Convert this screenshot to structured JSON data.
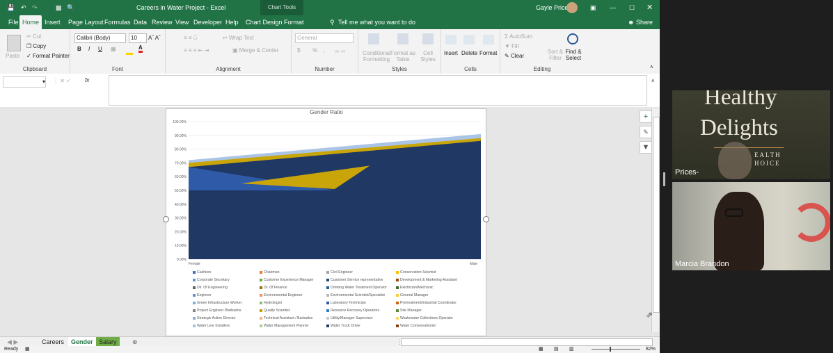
{
  "window": {
    "title": "Careers in Water Project  -  Excel",
    "context_title": "Chart Tools",
    "user": "Gayle Price",
    "share_label": "Share"
  },
  "ribbon_tabs": [
    "File",
    "Home",
    "Insert",
    "Page Layout",
    "Formulas",
    "Data",
    "Review",
    "View",
    "Developer",
    "Help",
    "Chart Design",
    "Format"
  ],
  "tell_me": "Tell me what you want to do",
  "ribbon": {
    "clipboard": {
      "paste": "Paste",
      "cut": "Cut",
      "copy": "Copy",
      "format_painter": "Format Painter",
      "label": "Clipboard"
    },
    "font": {
      "name": "Calibri (Body)",
      "size": "10",
      "label": "Font",
      "bold": "B",
      "italic": "I",
      "underline": "U"
    },
    "alignment": {
      "wrap": "Wrap Text",
      "merge": "Merge & Center",
      "label": "Alignment"
    },
    "number": {
      "format": "General",
      "label": "Number",
      "currency": "$",
      "percent": "%",
      "comma": ","
    },
    "styles": {
      "conditional": "Conditional Formatting",
      "format_table": "Format as Table",
      "cell_styles": "Cell Styles",
      "label": "Styles"
    },
    "cells": {
      "insert": "Insert",
      "delete": "Delete",
      "format": "Format",
      "label": "Cells"
    },
    "editing": {
      "autosum": "AutoSum",
      "fill": "Fill",
      "clear": "Clear",
      "sort": "Sort & Filter",
      "find": "Find & Select",
      "label": "Editing"
    }
  },
  "formula": {
    "fx": "fx"
  },
  "chart_data": {
    "type": "area",
    "title": "Gender Ratio",
    "categories": [
      "Female",
      "Male"
    ],
    "yticks": [
      "100.00%",
      "90.00%",
      "80.00%",
      "70.00%",
      "60.00%",
      "50.00%",
      "40.00%",
      "30.00%",
      "20.00%",
      "10.00%",
      "0.00%"
    ],
    "ylim": [
      0,
      100
    ],
    "series": [
      {
        "name": "Water Conservationist",
        "values": [
          50,
          86
        ],
        "color": "#8b3a10"
      },
      {
        "name": "Water Truck Driver",
        "values": [
          67,
          86
        ],
        "color": "#1f3864"
      },
      {
        "name": "Wastewater Collections Operator",
        "values": [
          70,
          88
        ],
        "color": "#c9a50a"
      },
      {
        "name": "Cashiers",
        "values": [
          72,
          91
        ],
        "color": "#a9c4e6"
      }
    ],
    "legend": [
      {
        "name": "Cashiers",
        "color": "#4472c4"
      },
      {
        "name": "Chairman",
        "color": "#ed7d31"
      },
      {
        "name": "Civil Engineer",
        "color": "#a5a5a5"
      },
      {
        "name": "Conservation Scientist",
        "color": "#ffc000"
      },
      {
        "name": "Corporate Secretary",
        "color": "#5b9bd5"
      },
      {
        "name": "Customer Experience Manager",
        "color": "#70ad47"
      },
      {
        "name": "Customer Service representative",
        "color": "#264478"
      },
      {
        "name": "Development & Marketing Assistant",
        "color": "#9e480e"
      },
      {
        "name": "Dir. Of Engineering",
        "color": "#636363"
      },
      {
        "name": "Dr. Of Finance",
        "color": "#997300"
      },
      {
        "name": "Drinking Water Treatment Operator",
        "color": "#255e91"
      },
      {
        "name": "Electrician/Mechanic",
        "color": "#43682b"
      },
      {
        "name": "Engineer",
        "color": "#698ed0"
      },
      {
        "name": "Environmental Engineer",
        "color": "#f1975a"
      },
      {
        "name": "Environmental Scientist/Specialist",
        "color": "#b7b7b7"
      },
      {
        "name": "General Manager",
        "color": "#ffcd33"
      },
      {
        "name": "Green Infrastructure Worker",
        "color": "#7cafdd"
      },
      {
        "name": "Hydrologist",
        "color": "#8cc168"
      },
      {
        "name": "Laboratory Technician",
        "color": "#335aa1"
      },
      {
        "name": "Pretreatment/Industrial Coordinator",
        "color": "#d26012"
      },
      {
        "name": "Project Engineer /Barbados",
        "color": "#848484"
      },
      {
        "name": "Quality Scientist",
        "color": "#cc9a00"
      },
      {
        "name": "Resource Recovery Operators",
        "color": "#327dc2"
      },
      {
        "name": "Site Manager",
        "color": "#5a8a39"
      },
      {
        "name": "Strategic Action Director",
        "color": "#8faadc"
      },
      {
        "name": "Technical Assistant / Barbados",
        "color": "#f4b183"
      },
      {
        "name": "Utility/Manager Supervisor",
        "color": "#c9c9c9"
      },
      {
        "name": "Wastewater Collections Operator",
        "color": "#ffd966"
      },
      {
        "name": "Water Line Installers",
        "color": "#9dc3e6"
      },
      {
        "name": "Water Management Planner",
        "color": "#a9d18e"
      },
      {
        "name": "Water Truck Driver",
        "color": "#1f3864"
      },
      {
        "name": "Water Conservationist",
        "color": "#843c0c"
      }
    ]
  },
  "sheet_tabs": [
    "Careers",
    "Gender",
    "Salary"
  ],
  "status": {
    "ready": "Ready",
    "zoom": "82%"
  },
  "video": {
    "tile1_name": "Prices-",
    "tile1_bg_line1": "Healthy",
    "tile1_bg_line2": "Delights",
    "tile1_bg_line3": "EALTH",
    "tile1_bg_line4": "HOICE",
    "tile2_name": "Marcia Brandon"
  }
}
